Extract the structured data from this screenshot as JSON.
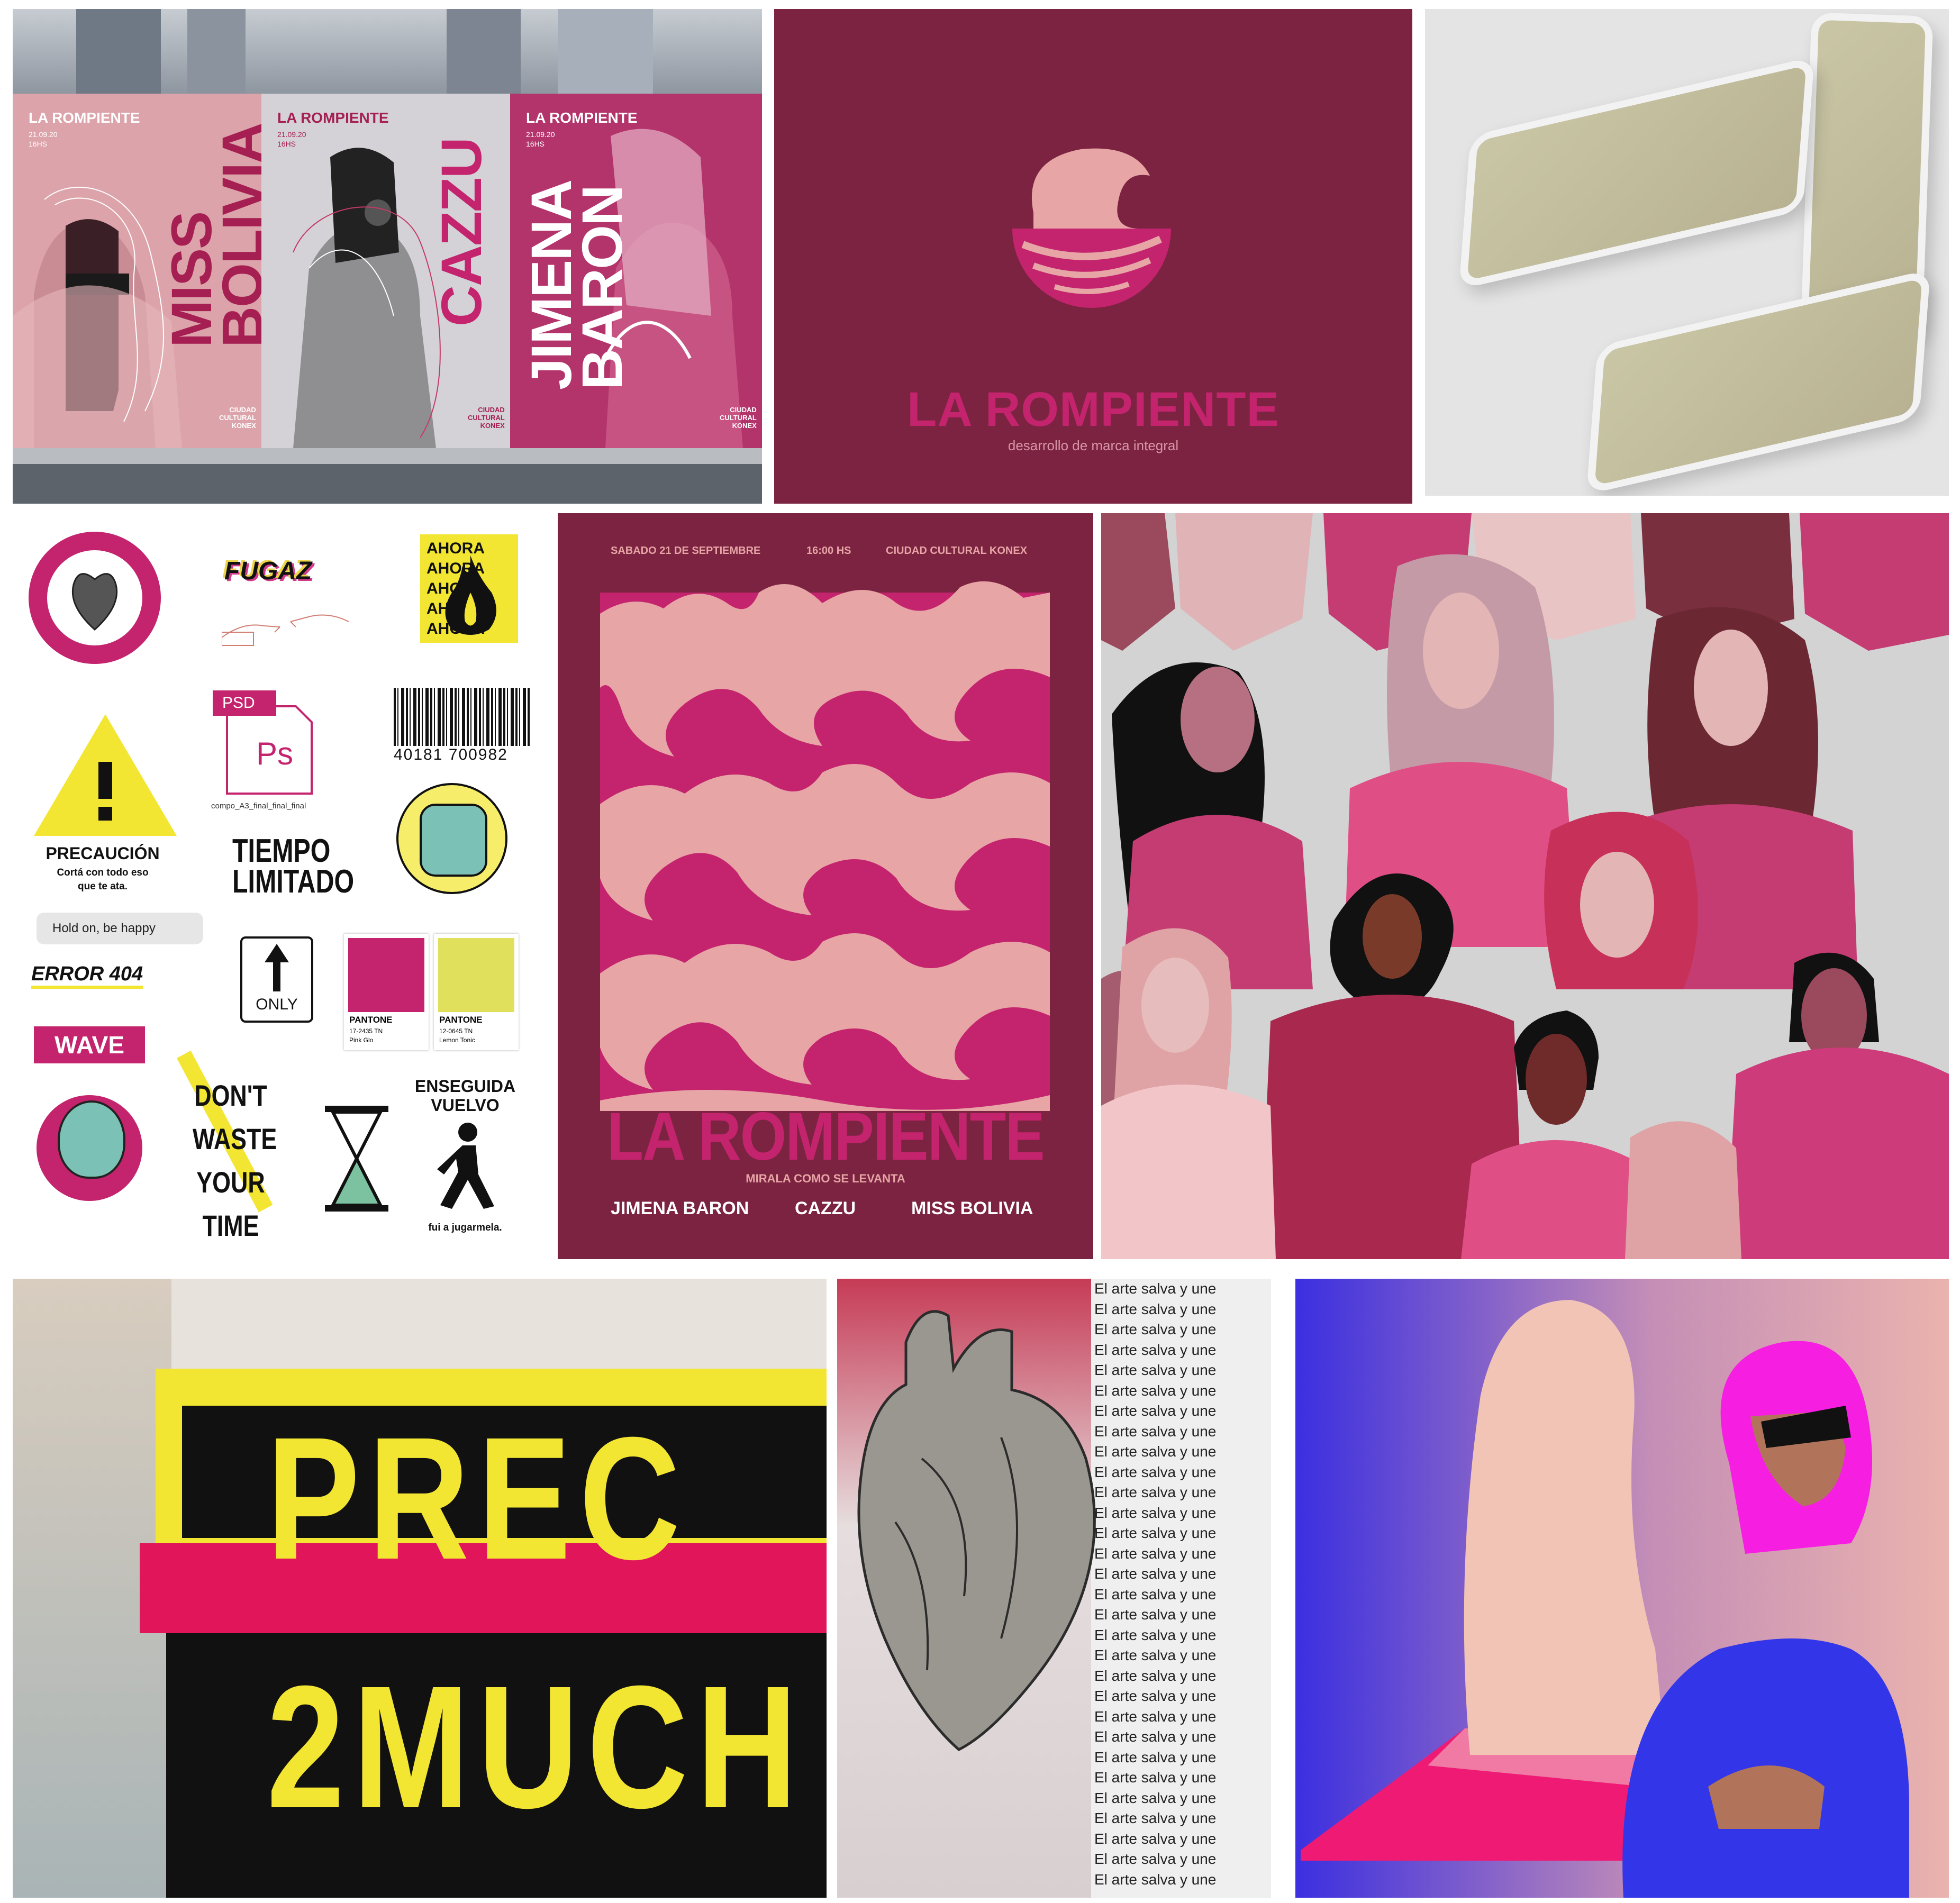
{
  "billboard": {
    "posters": [
      {
        "brand": "LA ROMPIENTE",
        "date": "21.09.20",
        "time": "16HS",
        "name_line1": "MISS",
        "name_line2": "BOLIVIA",
        "venue1": "CIUDAD",
        "venue2": "CULTURAL",
        "venue3": "KONEX"
      },
      {
        "brand": "LA ROMPIENTE",
        "date": "21.09.20",
        "time": "16HS",
        "name_line1": "CAZZU",
        "name_line2": "",
        "venue1": "CIUDAD",
        "venue2": "CULTURAL",
        "venue3": "KONEX"
      },
      {
        "brand": "LA ROMPIENTE",
        "date": "21.09.20",
        "time": "16HS",
        "name_line1": "JIMENA",
        "name_line2": "BARON",
        "venue1": "CIUDAD",
        "venue2": "CULTURAL",
        "venue3": "KONEX"
      }
    ]
  },
  "brand_panel": {
    "title": "LA ROMPIENTE",
    "subtitle": "desarrollo de marca integral"
  },
  "stickers": {
    "fugaz": "FUGAZ",
    "ahora": [
      "AHORA",
      "AHORA",
      "AHORA",
      "AHORA",
      "AHORA"
    ],
    "psd_tag": "PSD",
    "ps_logo": "Ps",
    "psd_filename": "compo_A3_final_final_final",
    "barcode_number": "40181 700982",
    "precaucion_title": "PRECAUCIÓN",
    "precaucion_sub1": "Cortá con todo eso",
    "precaucion_sub2": "que te ata.",
    "tiempo1": "TIEMPO",
    "tiempo2": "LIMITADO",
    "chat": "Hold on, be happy",
    "error": "ERROR 404",
    "wave": "WAVE",
    "only": "ONLY",
    "pantone1": {
      "label": "PANTONE",
      "code": "17-2435 TN",
      "name": "Pink Glo",
      "color": "#c4246e"
    },
    "pantone2": {
      "label": "PANTONE",
      "code": "12-0645 TN",
      "name": "Lemon Tonic",
      "color": "#e1e05d"
    },
    "dont_waste": [
      "DON'T",
      "WASTE",
      "YOUR",
      "TIME"
    ],
    "enseguida1": "ENSEGUIDA",
    "enseguida2": "VUELVO",
    "jugarmela": "fui a jugarmela."
  },
  "event_poster": {
    "date": "SABADO 21 DE SEPTIEMBRE",
    "time": "16:00 HS",
    "venue": "CIUDAD CULTURAL KONEX",
    "title": "LA ROMPIENTE",
    "tagline": "MIRALA COMO SE LEVANTA",
    "artists": [
      "JIMENA BARON",
      "CAZZU",
      "MISS BOLIVIA"
    ]
  },
  "collage": {
    "line1": "PREC",
    "line2": "2MUCH"
  },
  "newspaper": {
    "phrase": "El arte salva y une"
  },
  "colors": {
    "wine": "#7b2340",
    "pink": "#c4246e",
    "light_pink": "#e7a5a6",
    "yellow": "#f3e632"
  }
}
